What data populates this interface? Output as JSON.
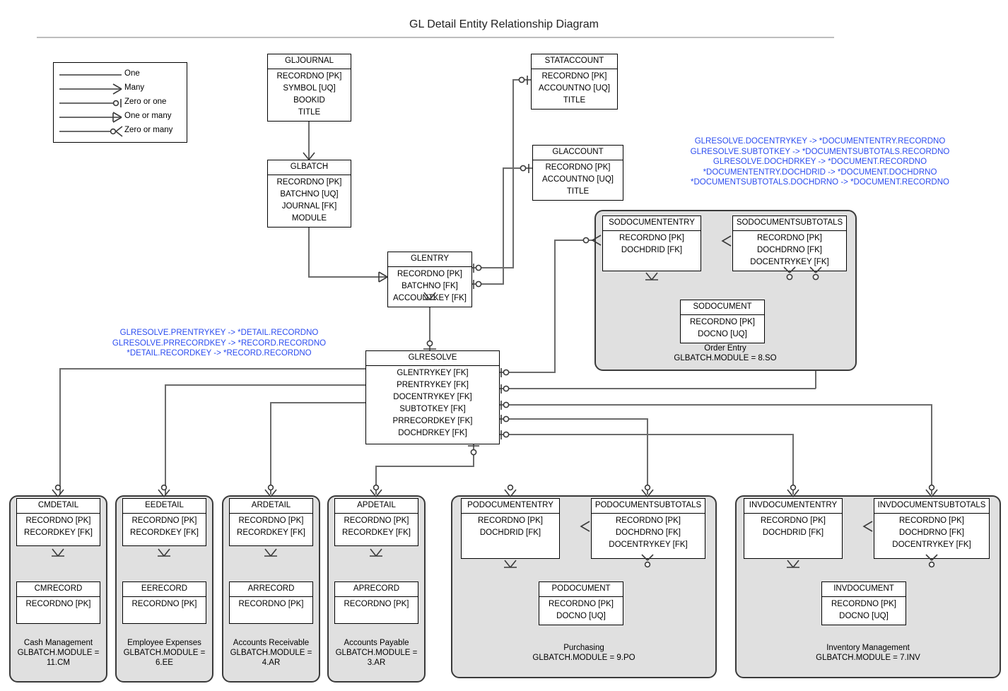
{
  "title": "GL Detail Entity Relationship Diagram",
  "legend": {
    "items": [
      {
        "label": "One",
        "symbol": "one"
      },
      {
        "label": "Many",
        "symbol": "many"
      },
      {
        "label": "Zero or one",
        "symbol": "zero-or-one"
      },
      {
        "label": "One or many",
        "symbol": "one-or-many"
      },
      {
        "label": "Zero or many",
        "symbol": "zero-or-many"
      }
    ]
  },
  "annotations": {
    "right": "GLRESOLVE.DOCENTRYKEY -> *DOCUMENTENTRY.RECORDNO\nGLRESOLVE.SUBTOTKEY -> *DOCUMENTSUBTOTALS.RECORDNO\nGLRESOLVE.DOCHDRKEY -> *DOCUMENT.RECORDNO\n*DOCUMENTENTRY.DOCHDRID -> *DOCUMENT.DOCHDRNO\n*DOCUMENTSUBTOTALS.DOCHDRNO -> *DOCUMENT.RECORDNO",
    "left": "GLRESOLVE.PRENTRYKEY -> *DETAIL.RECORDNO\nGLRESOLVE.PRRECORDKEY -> *RECORD.RECORDNO\n*DETAIL.RECORDKEY -> *RECORD.RECORDNO"
  },
  "entities": {
    "gljournal": {
      "name": "GLJOURNAL",
      "fields": [
        "RECORDNO [PK]",
        "SYMBOL [UQ]",
        "BOOKID",
        "TITLE"
      ]
    },
    "stataccount": {
      "name": "STATACCOUNT",
      "fields": [
        "RECORDNO [PK]",
        "ACCOUNTNO [UQ]",
        "TITLE"
      ]
    },
    "glaccount": {
      "name": "GLACCOUNT",
      "fields": [
        "RECORDNO [PK]",
        "ACCOUNTNO [UQ]",
        "TITLE"
      ]
    },
    "glbatch": {
      "name": "GLBATCH",
      "fields": [
        "RECORDNO [PK]",
        "BATCHNO [UQ]",
        "JOURNAL [FK]",
        "MODULE"
      ]
    },
    "glentry": {
      "name": "GLENTRY",
      "fields": [
        "RECORDNO [PK]",
        "BATCHNO [FK]",
        "ACCOUNTKEY [FK]"
      ]
    },
    "glresolve": {
      "name": "GLRESOLVE",
      "fields": [
        "GLENTRYKEY [FK]",
        "PRENTRYKEY [FK]",
        "DOCENTRYKEY [FK]",
        "SUBTOTKEY [FK]",
        "PRRECORDKEY [FK]",
        "DOCHDRKEY [FK]"
      ]
    },
    "sodocumententry": {
      "name": "SODOCUMENTENTRY",
      "fields": [
        "RECORDNO [PK]",
        "DOCHDRID [FK]"
      ]
    },
    "sodocumentsubtotals": {
      "name": "SODOCUMENTSUBTOTALS",
      "fields": [
        "RECORDNO [PK]",
        "DOCHDRNO [FK]",
        "DOCENTRYKEY [FK]"
      ]
    },
    "sodocument": {
      "name": "SODOCUMENT",
      "fields": [
        "RECORDNO [PK]",
        "DOCNO [UQ]"
      ]
    },
    "cmdetail": {
      "name": "CMDETAIL",
      "fields": [
        "RECORDNO [PK]",
        "RECORDKEY [FK]"
      ]
    },
    "cmrecord": {
      "name": "CMRECORD",
      "fields": [
        "RECORDNO [PK]"
      ]
    },
    "eedetail": {
      "name": "EEDETAIL",
      "fields": [
        "RECORDNO [PK]",
        "RECORDKEY [FK]"
      ]
    },
    "eerecord": {
      "name": "EERECORD",
      "fields": [
        "RECORDNO [PK]"
      ]
    },
    "ardetail": {
      "name": "ARDETAIL",
      "fields": [
        "RECORDNO [PK]",
        "RECORDKEY [FK]"
      ]
    },
    "arrecord": {
      "name": "ARRECORD",
      "fields": [
        "RECORDNO [PK]"
      ]
    },
    "apdetail": {
      "name": "APDETAIL",
      "fields": [
        "RECORDNO [PK]",
        "RECORDKEY [FK]"
      ]
    },
    "aprecord": {
      "name": "APRECORD",
      "fields": [
        "RECORDNO [PK]"
      ]
    },
    "podocumententry": {
      "name": "PODOCUMENTENTRY",
      "fields": [
        "RECORDNO [PK]",
        "DOCHDRID [FK]"
      ]
    },
    "podocumentsubtotals": {
      "name": "PODOCUMENTSUBTOTALS",
      "fields": [
        "RECORDNO [PK]",
        "DOCHDRNO [FK]",
        "DOCENTRYKEY [FK]"
      ]
    },
    "podocument": {
      "name": "PODOCUMENT",
      "fields": [
        "RECORDNO [PK]",
        "DOCNO [UQ]"
      ]
    },
    "invdocumententry": {
      "name": "INVDOCUMENTENTRY",
      "fields": [
        "RECORDNO [PK]",
        "DOCHDRID [FK]"
      ]
    },
    "invdocumentsubtotals": {
      "name": "INVDOCUMENTSUBTOTALS",
      "fields": [
        "RECORDNO [PK]",
        "DOCHDRNO [FK]",
        "DOCENTRYKEY [FK]"
      ]
    },
    "invdocument": {
      "name": "INVDOCUMENT",
      "fields": [
        "RECORDNO [PK]",
        "DOCNO [UQ]"
      ]
    }
  },
  "groups": {
    "order_entry": {
      "caption": "Order Entry\nGLBATCH.MODULE = 8.SO"
    },
    "cash": {
      "caption": "Cash Management\nGLBATCH.MODULE =\n11.CM"
    },
    "employee": {
      "caption": "Employee Expenses\nGLBATCH.MODULE =\n6.EE"
    },
    "receivable": {
      "caption": "Accounts Receivable\nGLBATCH.MODULE =\n4.AR"
    },
    "payable": {
      "caption": "Accounts Payable\nGLBATCH.MODULE =\n3.AR"
    },
    "purchasing": {
      "caption": "Purchasing\nGLBATCH.MODULE = 9.PO"
    },
    "inventory": {
      "caption": "Inventory Management\nGLBATCH.MODULE = 7.INV"
    }
  },
  "colors": {
    "group_fill": "#e0e0e0",
    "group_border": "#3a3a3a",
    "wire": "#6b6b6b",
    "annotation": "#2b4cf0",
    "entity_fill": "#ffffff",
    "entity_border": "#000000"
  }
}
